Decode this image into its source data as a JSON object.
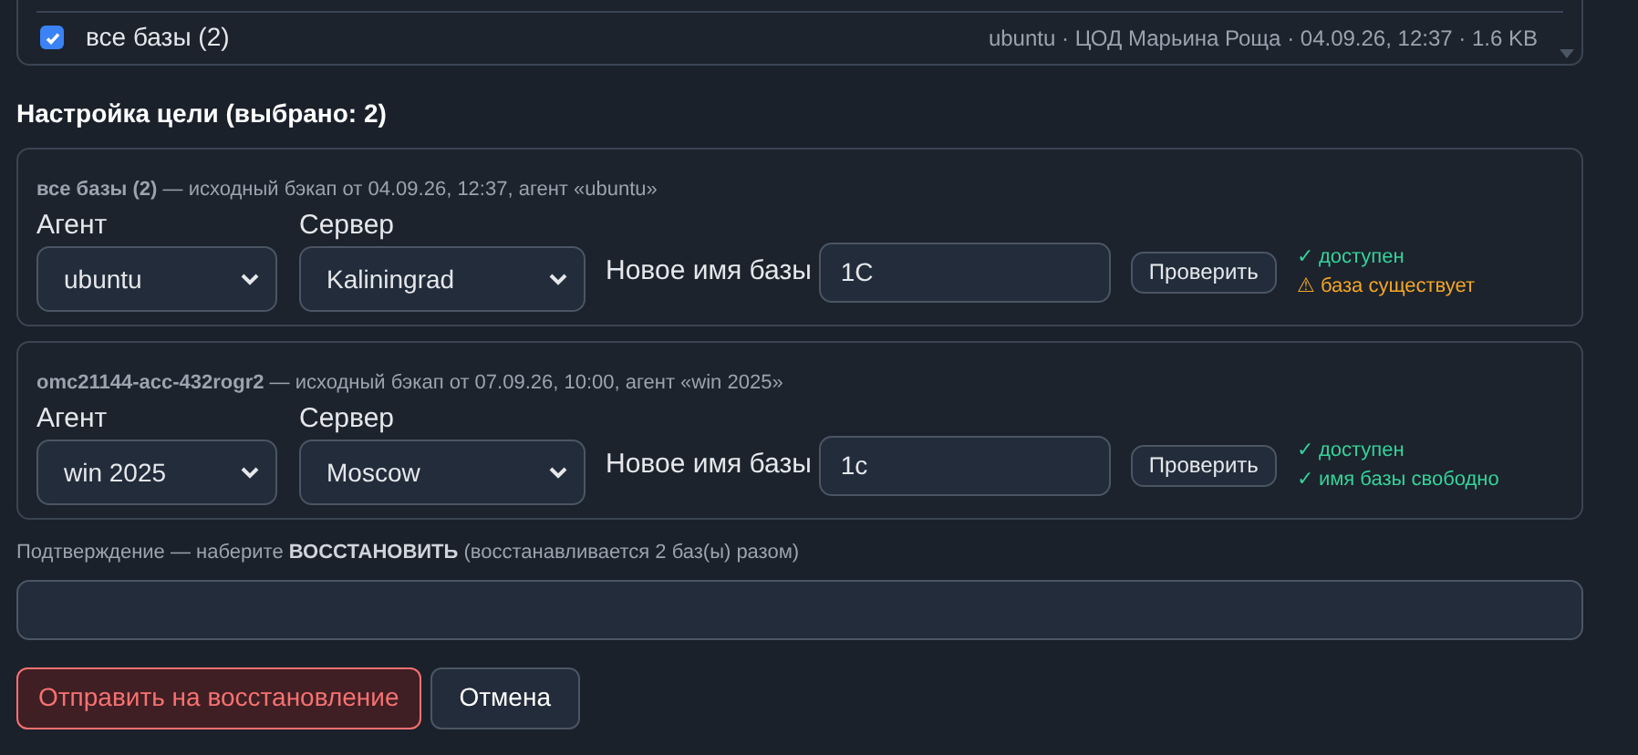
{
  "backup_list": {
    "rows": [
      {
        "checked": true,
        "label": "все базы (2)",
        "meta": "ubuntu · ЦОД Марьина Роща · 04.09.26, 12:37 · 1.6 KB"
      }
    ]
  },
  "target_heading": "Настройка цели (выбрано: 2)",
  "targets": [
    {
      "caption": "**все базы (2)** — исходный бэкап от 04.09.26, 12:37, агент «ubuntu»",
      "agent_label": "Агент",
      "agent": "ubuntu",
      "server_label": "Сервер",
      "server": "Kaliningrad",
      "name_label": "Новое имя базы",
      "name": "1C",
      "check_button": "Проверить",
      "statuses": [
        {
          "kind": "ok",
          "text": "✓ доступен"
        },
        {
          "kind": "warn",
          "text": "⚠ база существует"
        }
      ]
    },
    {
      "caption": "**omc21144-acc-432rogr2** — исходный бэкап от 07.09.26, 10:00, агент «win 2025»",
      "agent_label": "Агент",
      "agent": "win 2025",
      "server_label": "Сервер",
      "server": "Moscow",
      "name_label": "Новое имя базы",
      "name": "1c",
      "check_button": "Проверить",
      "statuses": [
        {
          "kind": "ok",
          "text": "✓ доступен"
        },
        {
          "kind": "ok",
          "text": "✓ имя базы свободно"
        }
      ]
    }
  ],
  "confirmation": {
    "label": "Подтверждение — наберите **ВОССТАНОВИТЬ** (восстанавливается 2 баз(ы) разом)"
  },
  "buttons": [
    {
      "kind": "danger",
      "label": "Отправить на восстановление"
    },
    {
      "kind": "secondary",
      "label": "Отмена"
    }
  ]
}
